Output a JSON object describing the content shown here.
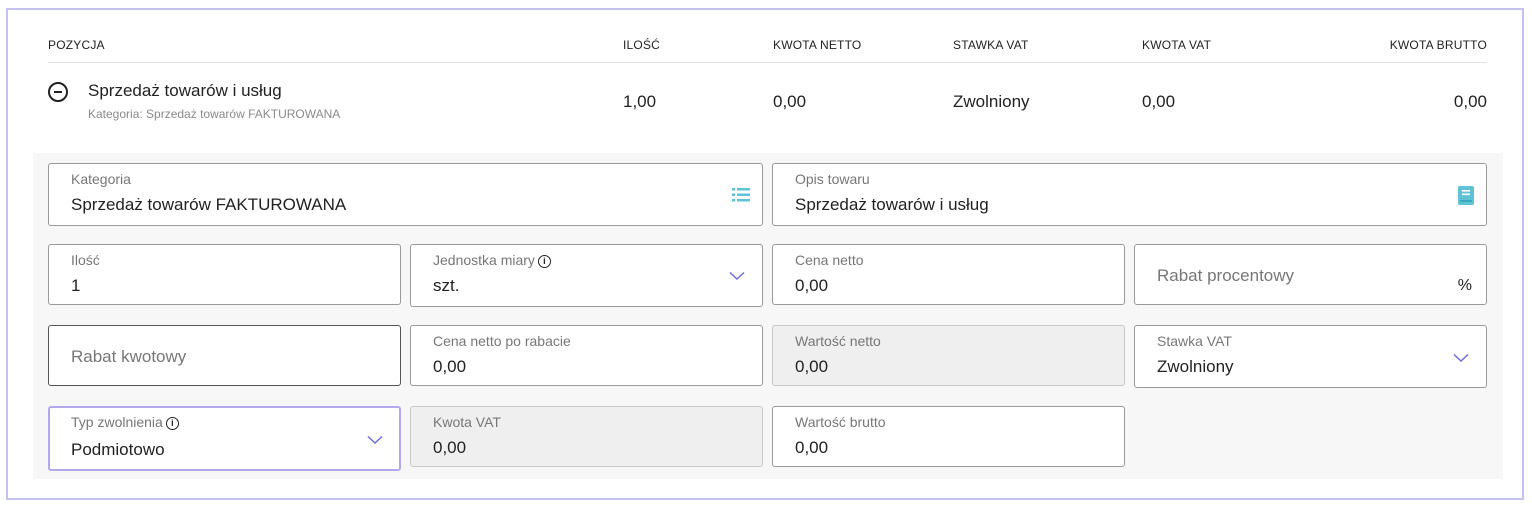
{
  "table": {
    "headers": {
      "position": "POZYCJA",
      "qty": "ILOŚĆ",
      "net": "KWOTA NETTO",
      "vat_rate": "STAWKA VAT",
      "vat_amount": "KWOTA VAT",
      "gross": "KWOTA BRUTTO"
    },
    "row": {
      "name": "Sprzedaż towarów i usług",
      "category_line": "Kategoria: Sprzedaż towarów FAKTUROWANA",
      "qty": "1,00",
      "net": "0,00",
      "vat_rate": "Zwolniony",
      "vat_amount": "0,00",
      "gross": "0,00"
    }
  },
  "form": {
    "category": {
      "label": "Kategoria",
      "value": "Sprzedaż towarów FAKTUROWANA",
      "icon": "list-icon"
    },
    "description": {
      "label": "Opis towaru",
      "value": "Sprzedaż towarów i usług",
      "icon": "book-icon"
    },
    "quantity": {
      "label": "Ilość",
      "value": "1"
    },
    "unit": {
      "label": "Jednostka miary",
      "value": "szt.",
      "info": "i"
    },
    "net_price": {
      "label": "Cena netto",
      "value": "0,00"
    },
    "discount_percent": {
      "placeholder": "Rabat procentowy",
      "suffix": "%"
    },
    "discount_amount": {
      "placeholder": "Rabat kwotowy"
    },
    "net_after_discount": {
      "label": "Cena netto po rabacie",
      "value": "0,00"
    },
    "net_value": {
      "label": "Wartość netto",
      "value": "0,00"
    },
    "vat_rate": {
      "label": "Stawka VAT",
      "value": "Zwolniony"
    },
    "exemption_type": {
      "label": "Typ zwolnienia",
      "value": "Podmiotowo",
      "info": "i"
    },
    "vat_amount": {
      "label": "Kwota VAT",
      "value": "0,00"
    },
    "gross_value": {
      "label": "Wartość brutto",
      "value": "0,00"
    }
  },
  "colors": {
    "accent_border": "#c6c2f0",
    "focus_border": "#b3a8ee",
    "icon_teal": "#5ec3d6",
    "chevron": "#6f6ad8"
  }
}
